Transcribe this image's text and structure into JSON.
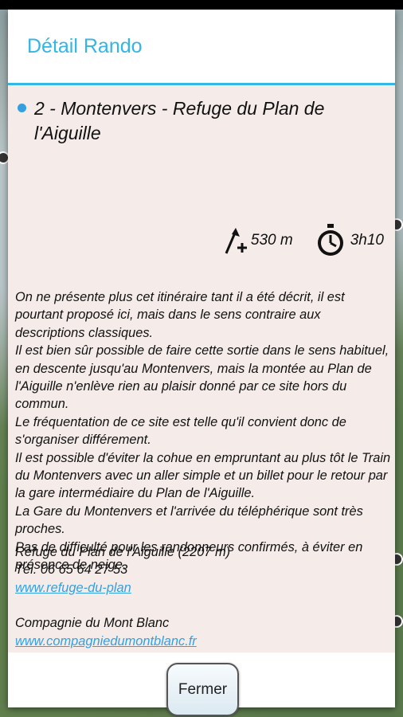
{
  "dialog": {
    "title": "Détail Rando",
    "route_title": "2 - Montenvers - Refuge du Plan de l'Aiguille",
    "elevation": "530 m",
    "duration": "3h10",
    "description": "On ne présente plus cet itinéraire tant il a été décrit, il est pourtant proposé ici, mais dans le sens contraire aux descriptions classiques.\nIl est bien sûr possible de faire cette sortie dans le sens habituel, en descente jusqu'au Montenvers, mais la montée au Plan de l'Aiguille n'enlève rien au plaisir donné par ce site hors du commun.\nLe fréquentation de ce site est telle qu'il convient donc de s'organiser différement.\nIl est possible d'éviter la cohue en empruntant au plus tôt le Train du Montenvers avec un aller simple et un billet pour le retour par la gare intermédiaire du Plan de l'Aiguille.\nLa Gare du Montenvers et l'arrivée du téléphérique sont très proches.\nPas de difficulté pour les randonneurs confirmés, à éviter en présence de neige.",
    "refuge_name": "Refuge du Plan de l'Aiguille (2207 m)",
    "refuge_phone": "Tél. 06 65 64 27 53",
    "refuge_link": "www.refuge-du-plan",
    "company_name": "Compagnie du Mont Blanc",
    "company_link": "www.compagniedumontblanc.fr",
    "close_label": "Fermer"
  },
  "colors": {
    "accent": "#33b5e5",
    "body_bg": "#f5ecea",
    "link": "#33a0e0"
  },
  "icons": {
    "elevation": "elevation-gain-icon",
    "duration": "stopwatch-icon",
    "bullet": "bullet-dot-icon"
  }
}
